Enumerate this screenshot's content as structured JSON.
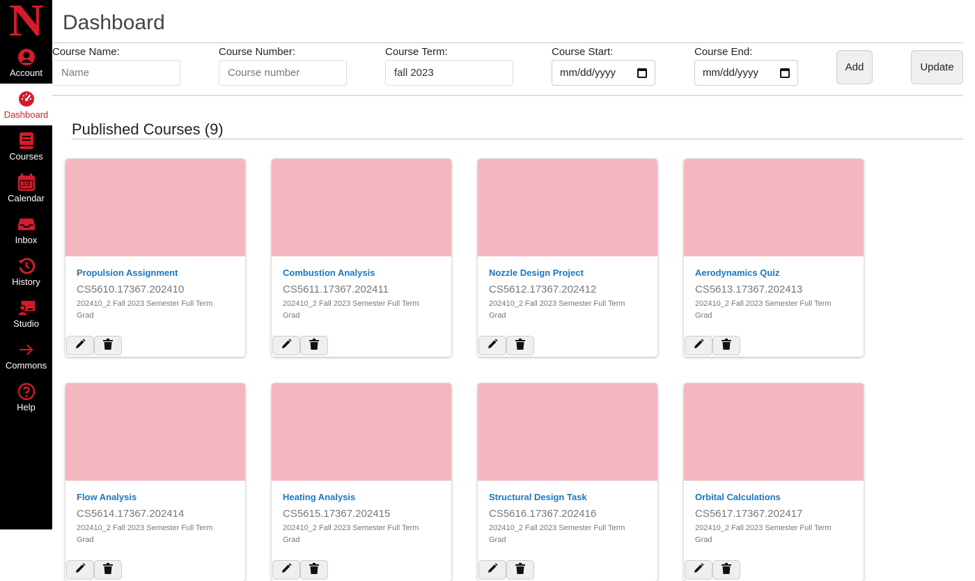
{
  "brand": {
    "logo_letter": "N",
    "accent": "#d41b2c"
  },
  "sidebar": {
    "items": [
      {
        "label": "Account",
        "icon": "account-icon"
      },
      {
        "label": "Dashboard",
        "icon": "dashboard-icon",
        "active": true
      },
      {
        "label": "Courses",
        "icon": "courses-icon"
      },
      {
        "label": "Calendar",
        "icon": "calendar-icon",
        "date": "19"
      },
      {
        "label": "Inbox",
        "icon": "inbox-icon"
      },
      {
        "label": "History",
        "icon": "history-icon"
      },
      {
        "label": "Studio",
        "icon": "studio-icon"
      },
      {
        "label": "Commons",
        "icon": "commons-icon"
      },
      {
        "label": "Help",
        "icon": "help-icon"
      }
    ]
  },
  "header": {
    "title": "Dashboard"
  },
  "form": {
    "course_name": {
      "label": "Course Name:",
      "placeholder": "Name",
      "value": ""
    },
    "course_number": {
      "label": "Course Number:",
      "placeholder": "Course number",
      "value": ""
    },
    "course_term": {
      "label": "Course Term:",
      "placeholder": "",
      "value": "fall 2023"
    },
    "course_start": {
      "label": "Course Start:",
      "value": "mm/dd/yyyy"
    },
    "course_end": {
      "label": "Course End:",
      "value": "mm/dd/yyyy"
    },
    "add_label": "Add",
    "update_label": "Update"
  },
  "section": {
    "title": "Published Courses (9)"
  },
  "courses": [
    {
      "title": "Propulsion Assignment",
      "code": "CS5610.17367.202410",
      "term": "202410_2 Fall 2023 Semester Full Term Grad",
      "color": "#f4b7c0"
    },
    {
      "title": "Combustion Analysis",
      "code": "CS5611.17367.202411",
      "term": "202410_2 Fall 2023 Semester Full Term Grad",
      "color": "#f4b7c0"
    },
    {
      "title": "Nozzle Design Project",
      "code": "CS5612.17367.202412",
      "term": "202410_2 Fall 2023 Semester Full Term Grad",
      "color": "#f4b7c0"
    },
    {
      "title": "Aerodynamics Quiz",
      "code": "CS5613.17367.202413",
      "term": "202410_2 Fall 2023 Semester Full Term Grad",
      "color": "#f4b7c0"
    },
    {
      "title": "Flow Analysis",
      "code": "CS5614.17367.202414",
      "term": "202410_2 Fall 2023 Semester Full Term Grad",
      "color": "#f4b7c0"
    },
    {
      "title": "Heating Analysis",
      "code": "CS5615.17367.202415",
      "term": "202410_2 Fall 2023 Semester Full Term Grad",
      "color": "#f4b7c0"
    },
    {
      "title": "Structural Design Task",
      "code": "CS5616.17367.202416",
      "term": "202410_2 Fall 2023 Semester Full Term Grad",
      "color": "#f4b7c0"
    },
    {
      "title": "Orbital Calculations",
      "code": "CS5617.17367.202417",
      "term": "202410_2 Fall 2023 Semester Full Term Grad",
      "color": "#f4b7c0"
    }
  ]
}
